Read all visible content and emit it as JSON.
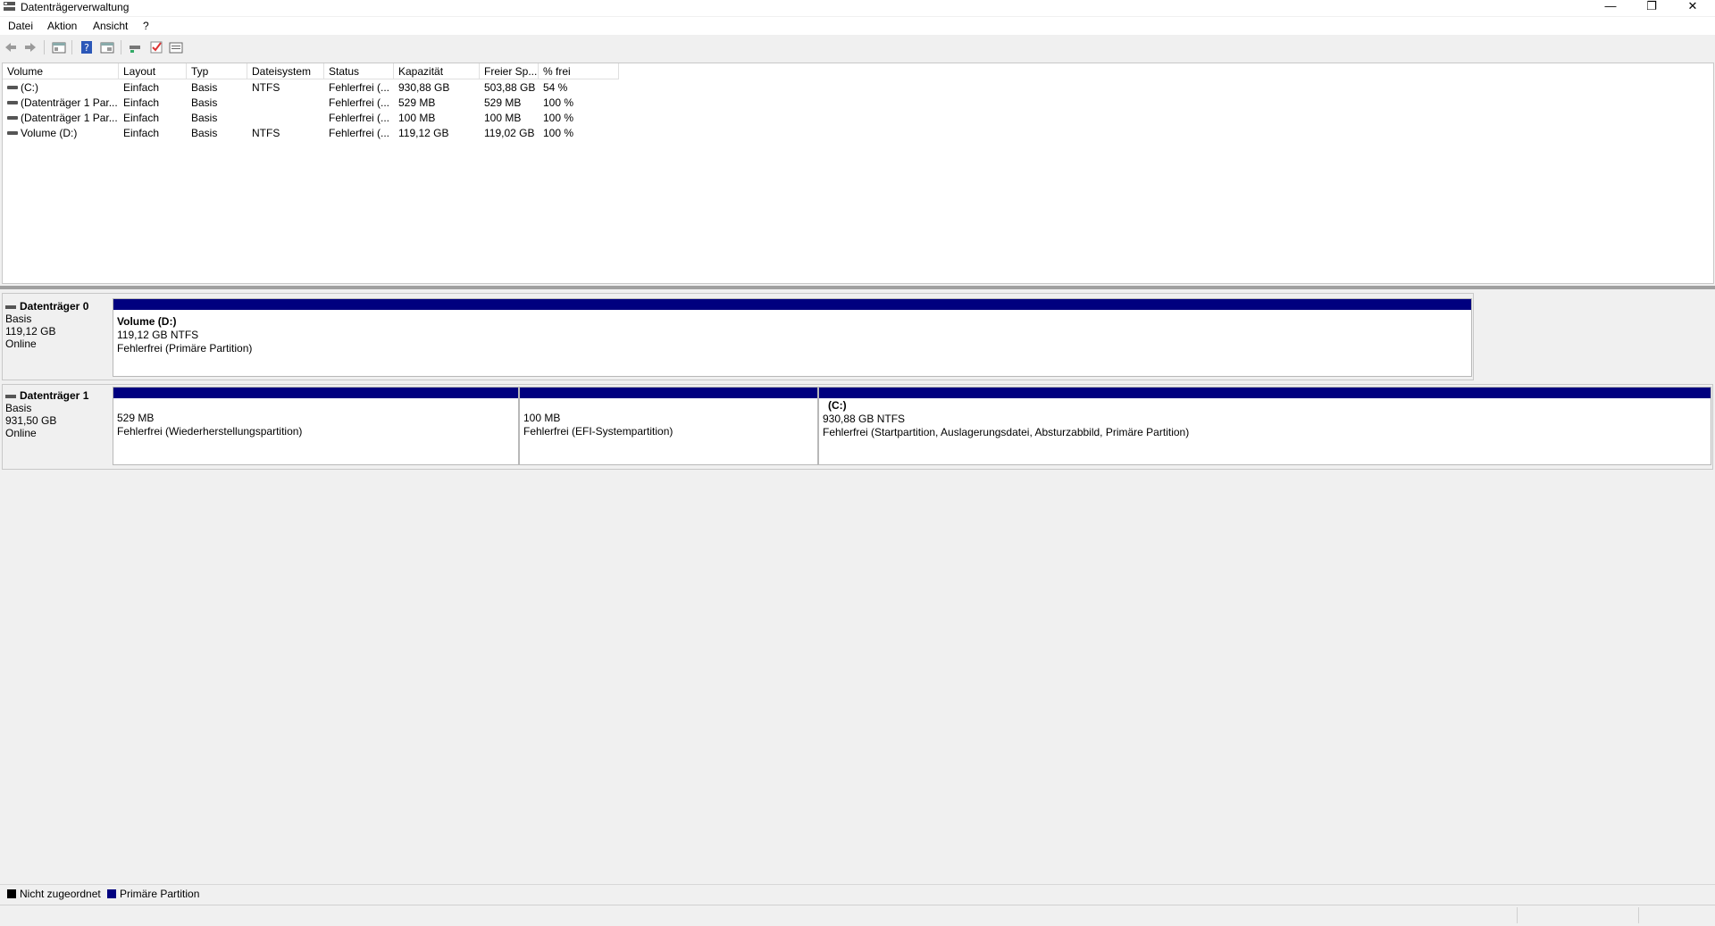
{
  "window": {
    "title": "Datenträgerverwaltung",
    "minimize_glyph": "—",
    "restore_glyph": "❐",
    "close_glyph": "✕"
  },
  "menu": {
    "items": [
      "Datei",
      "Aktion",
      "Ansicht",
      "?"
    ]
  },
  "toolbar": {
    "icons": [
      "back-arrow-icon",
      "forward-arrow-icon",
      "console-tree-icon",
      "help-icon",
      "properties-icon",
      "connect-icon",
      "check-icon",
      "settings-list-icon"
    ]
  },
  "volume_table": {
    "columns": [
      "Volume",
      "Layout",
      "Typ",
      "Dateisystem",
      "Status",
      "Kapazität",
      "Freier Sp...",
      "% frei"
    ],
    "rows": [
      [
        "(C:)",
        "Einfach",
        "Basis",
        "NTFS",
        "Fehlerfrei (...",
        "930,88 GB",
        "503,88 GB",
        "54 %"
      ],
      [
        "(Datenträger 1 Par...",
        "Einfach",
        "Basis",
        "",
        "Fehlerfrei (...",
        "529 MB",
        "529 MB",
        "100 %"
      ],
      [
        "(Datenträger 1 Par...",
        "Einfach",
        "Basis",
        "",
        "Fehlerfrei (...",
        "100 MB",
        "100 MB",
        "100 %"
      ],
      [
        "Volume (D:)",
        "Einfach",
        "Basis",
        "NTFS",
        "Fehlerfrei (...",
        "119,12 GB",
        "119,02 GB",
        "100 %"
      ]
    ]
  },
  "disks": [
    {
      "name": "Datenträger 0",
      "type": "Basis",
      "size": "119,12 GB",
      "state": "Online",
      "partitions": [
        {
          "title": "Volume  (D:)",
          "size_fs": "119,12 GB NTFS",
          "status": "Fehlerfrei (Primäre Partition)"
        }
      ]
    },
    {
      "name": "Datenträger 1",
      "type": "Basis",
      "size": "931,50 GB",
      "state": "Online",
      "partitions": [
        {
          "title": "",
          "size_fs": "529 MB",
          "status": "Fehlerfrei (Wiederherstellungspartition)"
        },
        {
          "title": "",
          "size_fs": "100 MB",
          "status": "Fehlerfrei (EFI-Systempartition)"
        },
        {
          "title": "(C:)",
          "size_fs": "930,88 GB NTFS",
          "status": "Fehlerfrei (Startpartition, Auslagerungsdatei, Absturzabbild, Primäre Partition)"
        }
      ]
    }
  ],
  "legend": {
    "items": [
      {
        "label": "Nicht zugeordnet",
        "color": "#000000"
      },
      {
        "label": "Primäre Partition",
        "color": "#00007f"
      }
    ]
  },
  "colors": {
    "primary_partition": "#00007f",
    "unallocated": "#000000"
  }
}
